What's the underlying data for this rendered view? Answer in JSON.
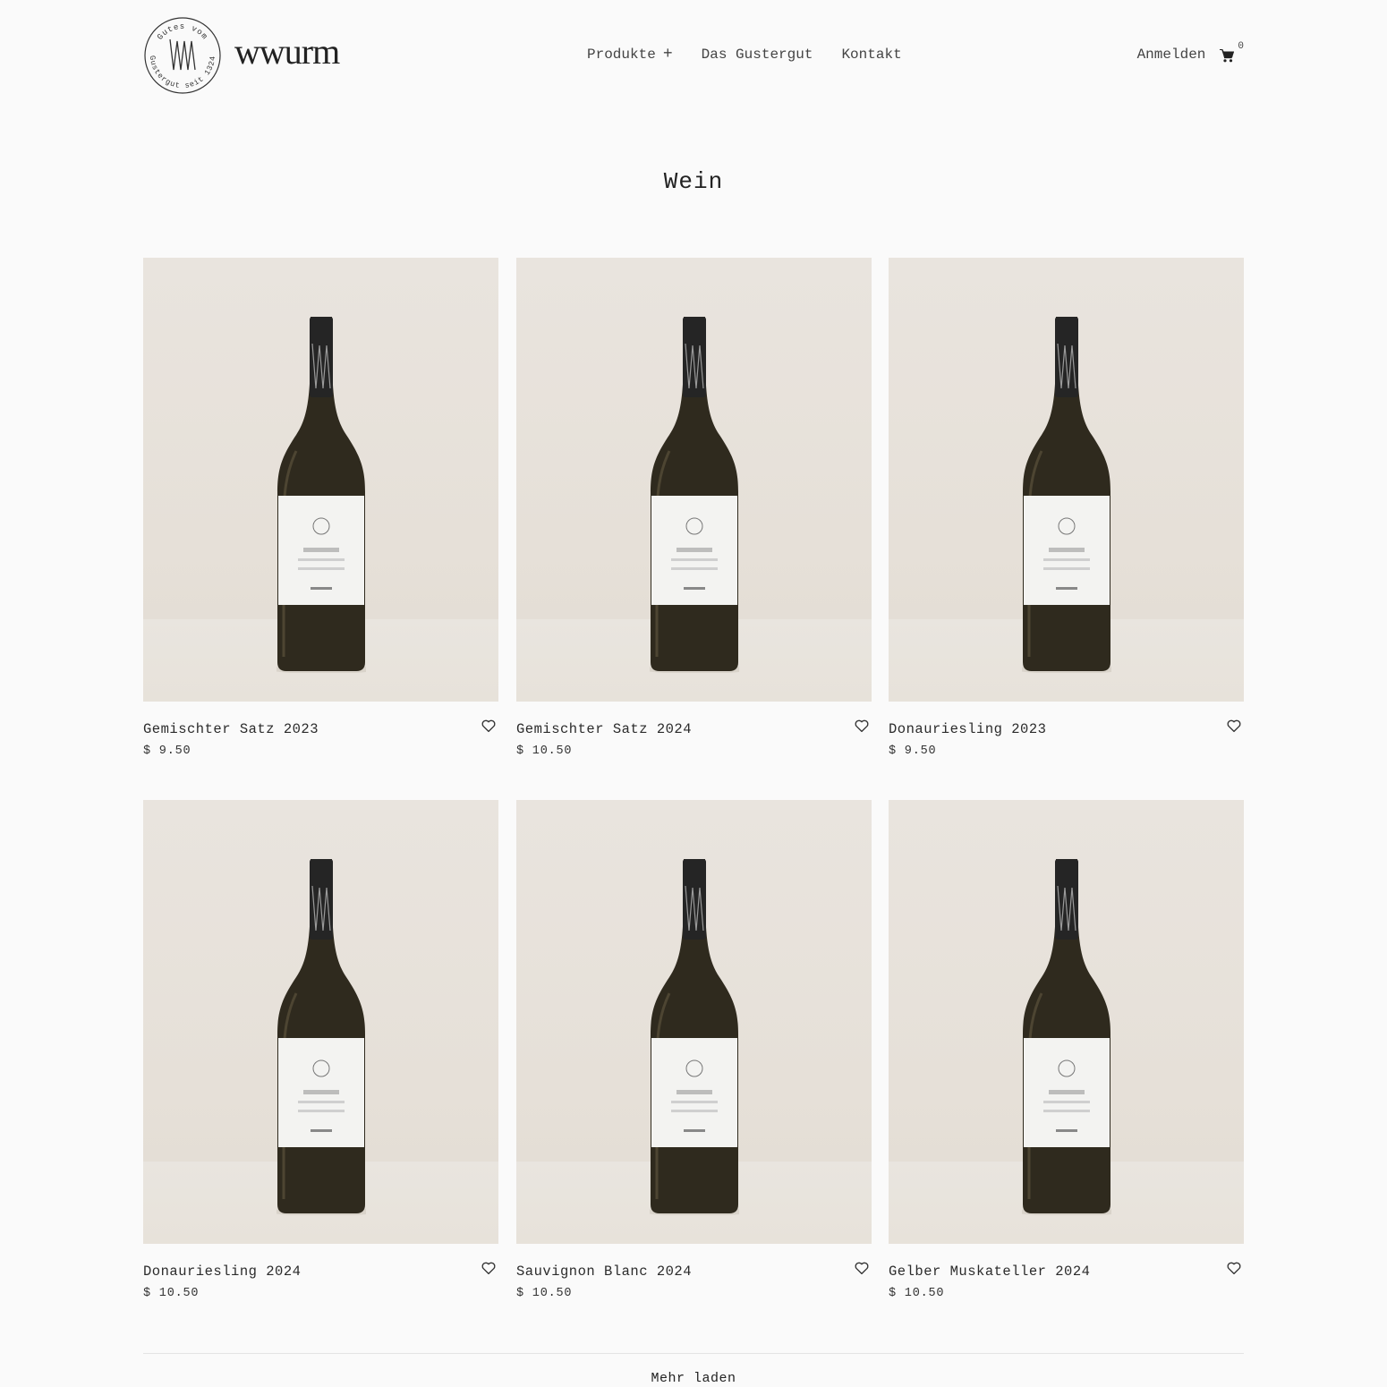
{
  "header": {
    "seal_text_top": "Gutes vom",
    "seal_text_bottom": "Gustergut seit 1324",
    "brand": "wwurm",
    "nav": [
      {
        "label": "Produkte",
        "icon": "plus-icon"
      },
      {
        "label": "Das Gustergut"
      },
      {
        "label": "Kontakt"
      }
    ],
    "login_label": "Anmelden",
    "cart_icon": "cart-icon",
    "cart_count": "0"
  },
  "page": {
    "title": "Wein",
    "load_more_label": "Mehr laden"
  },
  "products": [
    {
      "name": "Gemischter Satz 2023",
      "price": "$ 9.50"
    },
    {
      "name": "Gemischter Satz 2024",
      "price": "$ 10.50"
    },
    {
      "name": "Donauriesling 2023",
      "price": "$ 9.50"
    },
    {
      "name": "Donauriesling 2024",
      "price": "$ 10.50"
    },
    {
      "name": "Sauvignon Blanc 2024",
      "price": "$ 10.50"
    },
    {
      "name": "Gelber Muskateller 2024",
      "price": "$ 10.50"
    }
  ],
  "colors": {
    "background": "#fafafa",
    "text": "#2b2b2b",
    "photo_backdrop": "#e8e3dc"
  }
}
